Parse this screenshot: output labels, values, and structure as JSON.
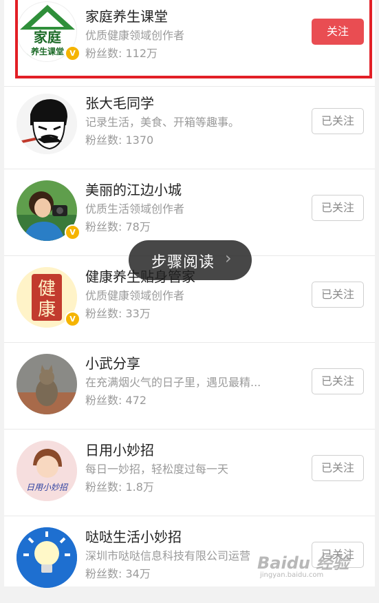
{
  "users": [
    {
      "name": "家庭养生课堂",
      "desc": "优质健康领域创作者",
      "fans": "粉丝数: 112万",
      "button": "关注",
      "followed": false,
      "verified": true
    },
    {
      "name": "张大毛同学",
      "desc": "记录生活，美食、开箱等趣事。",
      "fans": "粉丝数: 1370",
      "button": "已关注",
      "followed": true,
      "verified": false
    },
    {
      "name": "美丽的江边小城",
      "desc": "优质生活领域创作者",
      "fans": "粉丝数: 78万",
      "button": "已关注",
      "followed": true,
      "verified": true
    },
    {
      "name": "健康养生贴身管家",
      "desc": "优质健康领域创作者",
      "fans": "粉丝数: 33万",
      "button": "已关注",
      "followed": true,
      "verified": true
    },
    {
      "name": "小武分享",
      "desc": "在充满烟火气的日子里，遇见最精...",
      "fans": "粉丝数: 472",
      "button": "已关注",
      "followed": true,
      "verified": false
    },
    {
      "name": "日用小妙招",
      "desc": "每日一妙招，轻松度过每一天",
      "fans": "粉丝数: 1.8万",
      "button": "已关注",
      "followed": true,
      "verified": false
    },
    {
      "name": "哒哒生活小妙招",
      "desc": "深圳市哒哒信息科技有限公司运营",
      "fans": "粉丝数: 34万",
      "button": "已关注",
      "followed": true,
      "verified": false
    }
  ],
  "avatar_text": {
    "a1_top": "家庭",
    "a1_bottom": "养生课堂",
    "a4_top": "健",
    "a4_bottom": "康",
    "a6": "日用小妙招"
  },
  "overlay": {
    "label": "步骤阅读",
    "chevron": "›"
  },
  "watermark": {
    "brand": "Baidu 经验",
    "url": "jingyan.baidu.com"
  },
  "icons": {
    "verified": "v-badge-icon",
    "chevron": "chevron-right-icon"
  },
  "colors": {
    "follow": "#e94d52",
    "highlight": "#e21f26",
    "verified": "#f5b400"
  }
}
